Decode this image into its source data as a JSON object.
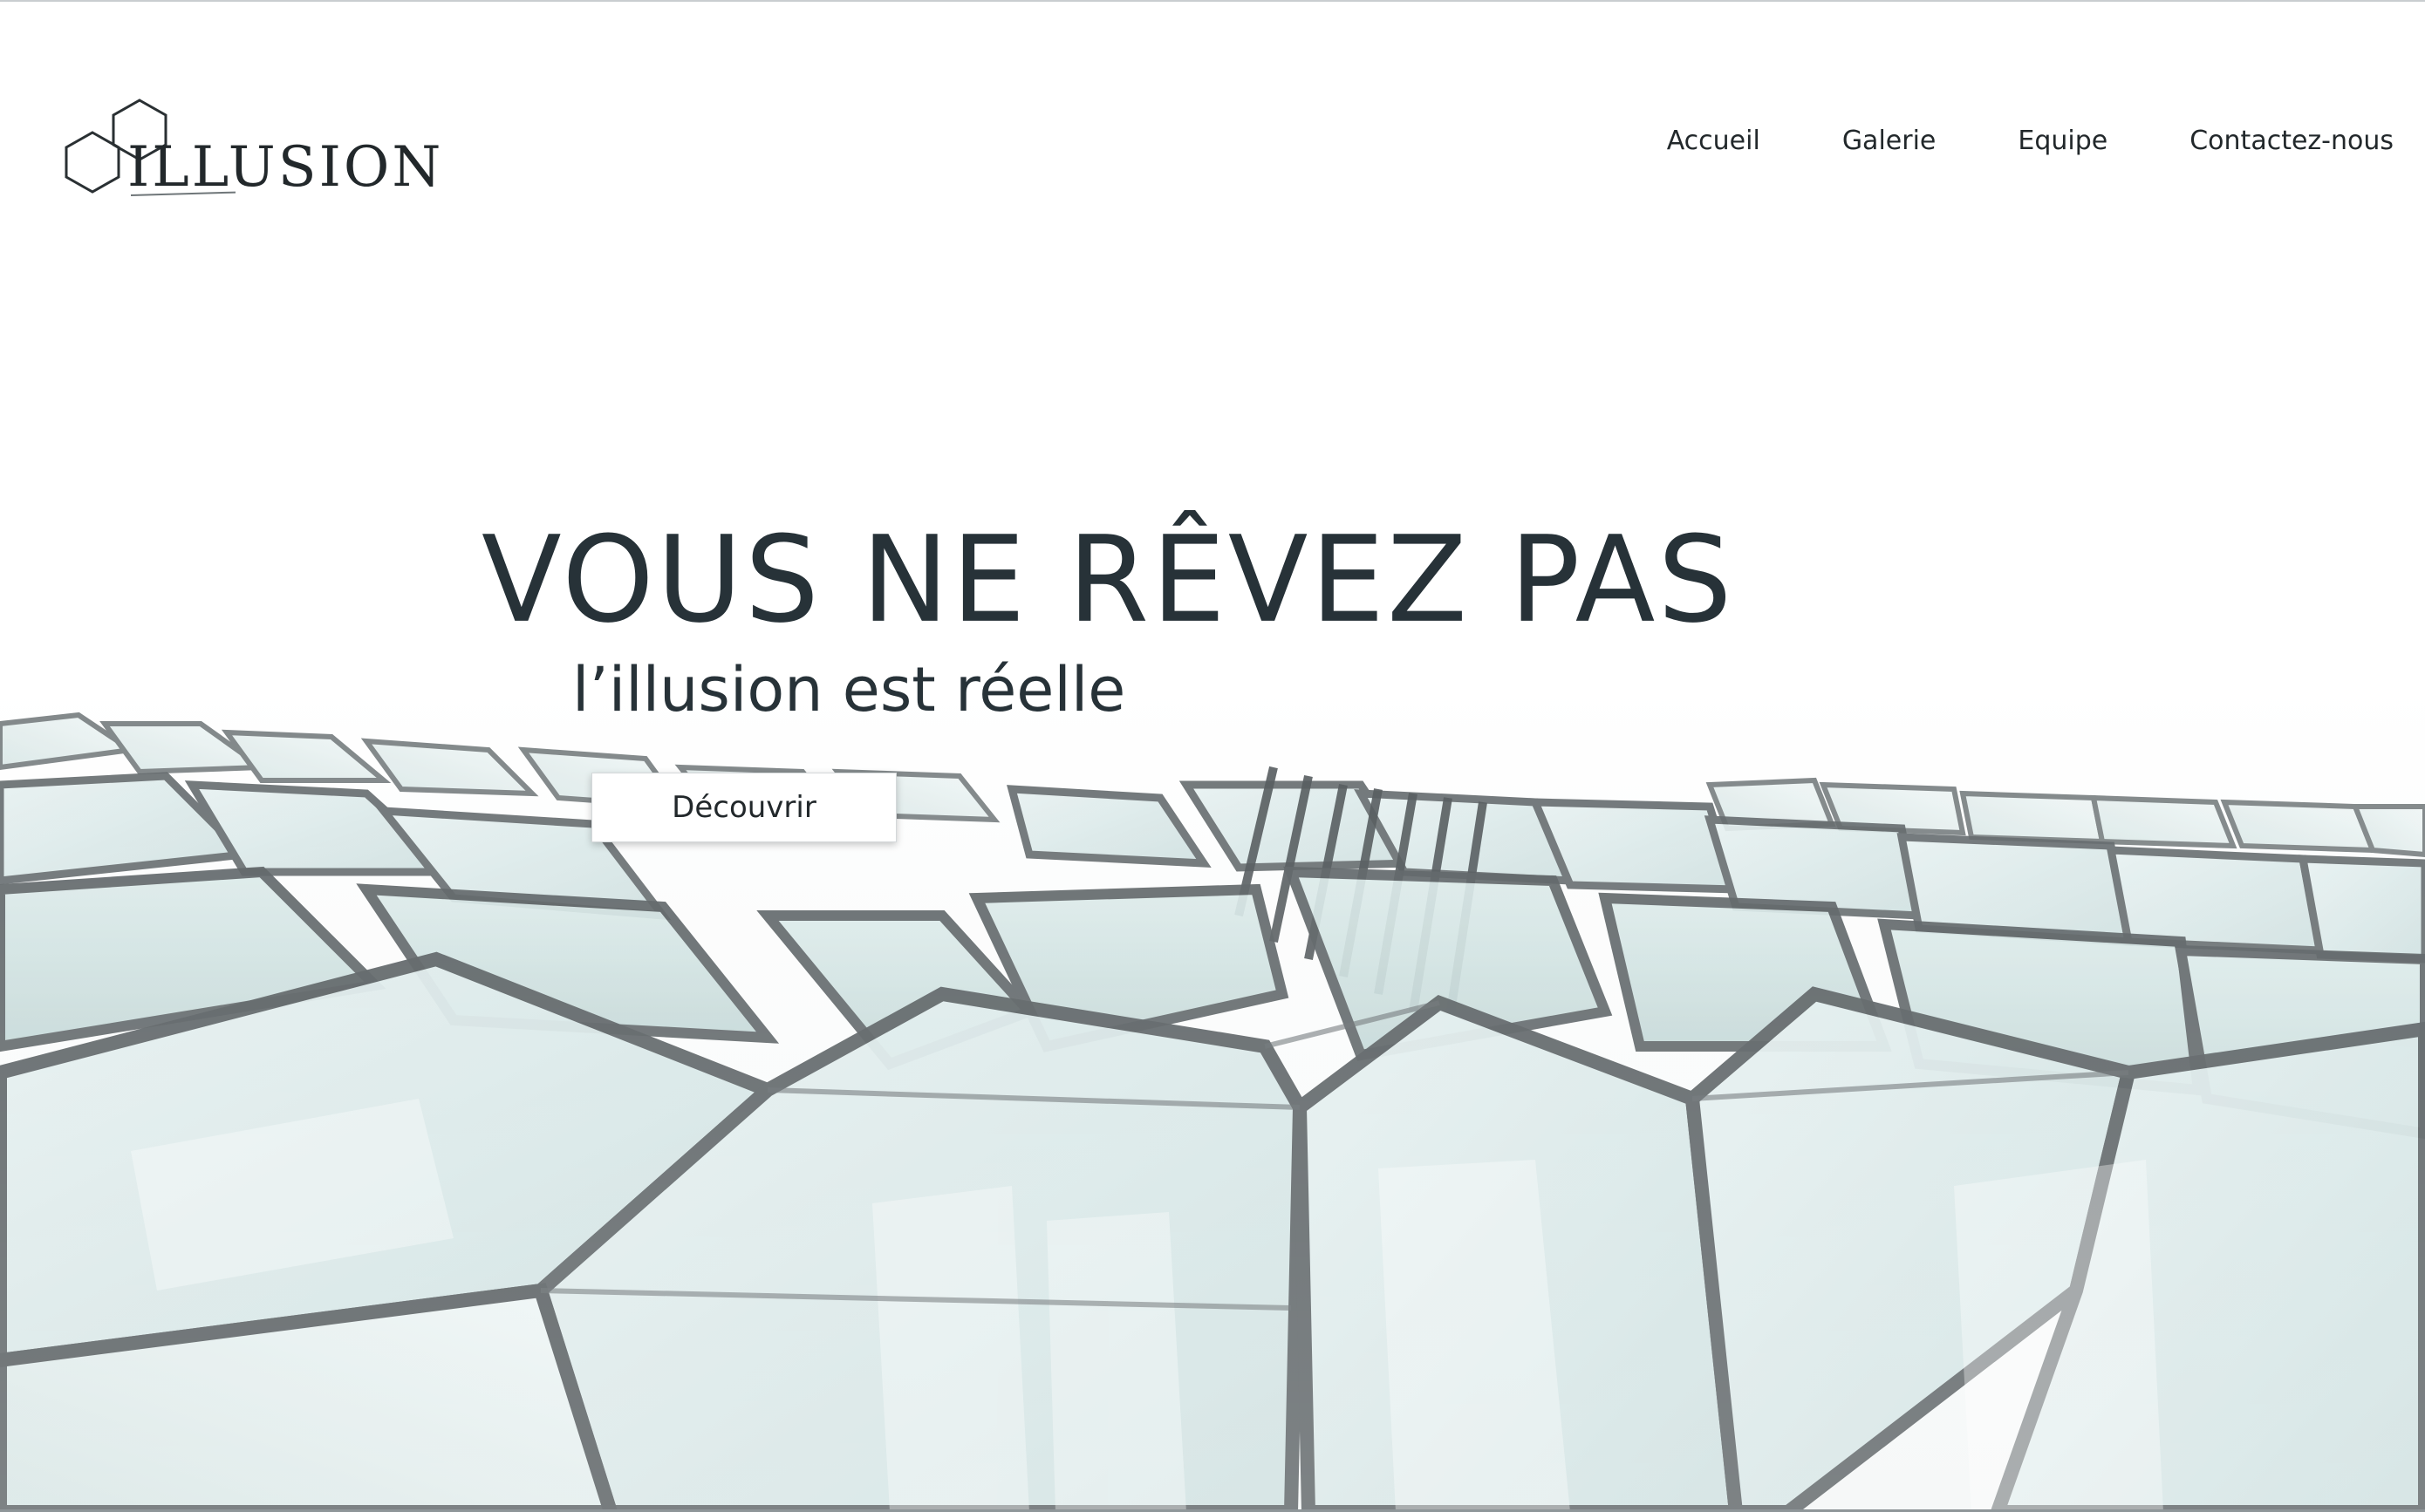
{
  "header": {
    "logo_text": "ILLUSION",
    "nav": [
      {
        "label": "Accueil"
      },
      {
        "label": "Galerie"
      },
      {
        "label": "Equipe"
      },
      {
        "label": "Contactez-nous"
      }
    ]
  },
  "hero": {
    "title": "VOUS NE RÊVEZ PAS",
    "subtitle": "l’illusion est réelle",
    "cta_label": "Découvrir",
    "background_image": "glass-facade-photo"
  },
  "colors": {
    "text": "#273238",
    "glass_tint": "#d4ecec",
    "frame": "#4d5558",
    "background": "#ffffff"
  }
}
